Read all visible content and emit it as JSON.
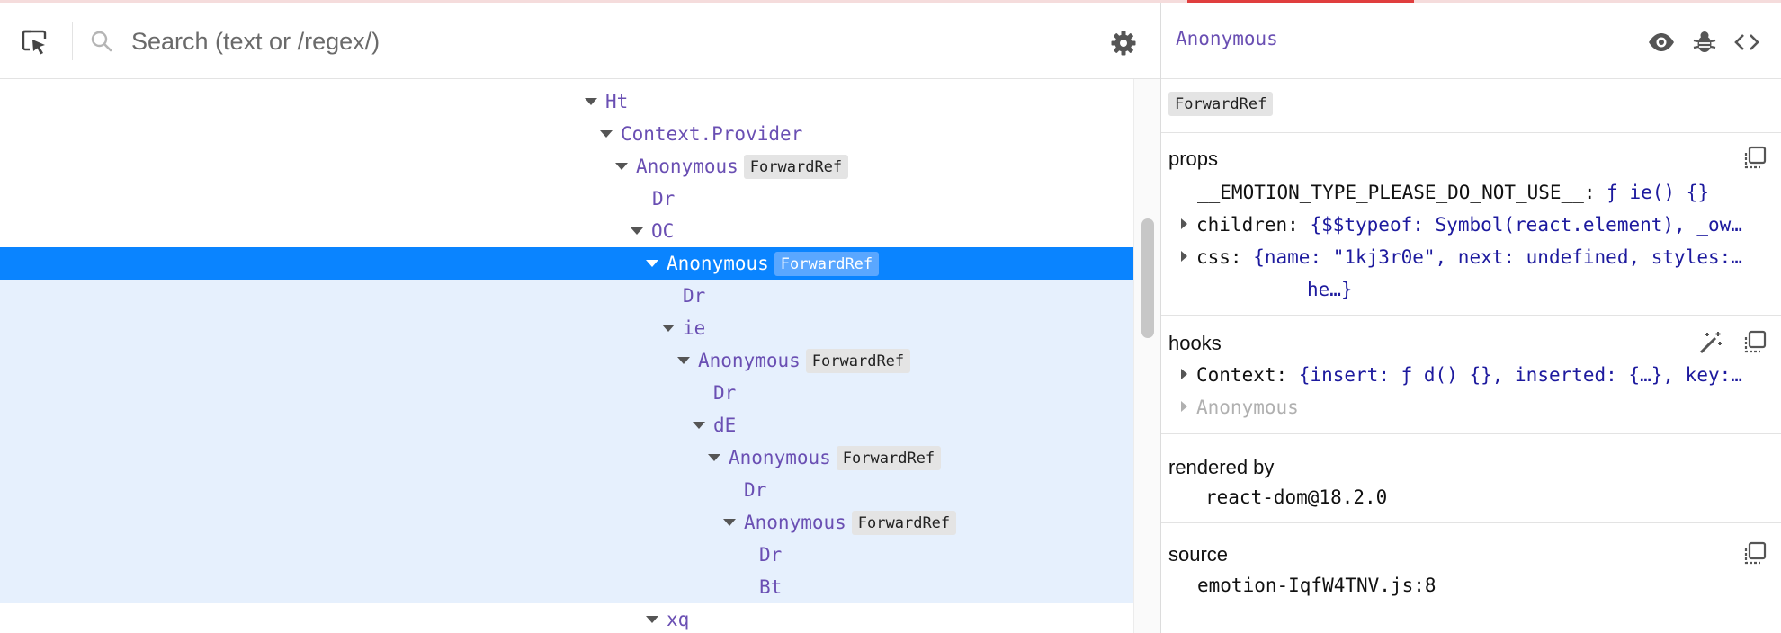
{
  "toolbar": {
    "search_placeholder": "Search (text or /regex/)"
  },
  "tree": {
    "partial_top_label": "ht",
    "rows": [
      {
        "label": "Ht",
        "badge": ""
      },
      {
        "label": "Context.Provider",
        "badge": ""
      },
      {
        "label": "Anonymous",
        "badge": "ForwardRef"
      },
      {
        "label": "Dr",
        "badge": ""
      },
      {
        "label": "OC",
        "badge": ""
      },
      {
        "label": "Anonymous",
        "badge": "ForwardRef"
      },
      {
        "label": "Dr",
        "badge": ""
      },
      {
        "label": "ie",
        "badge": ""
      },
      {
        "label": "Anonymous",
        "badge": "ForwardRef"
      },
      {
        "label": "Dr",
        "badge": ""
      },
      {
        "label": "dE",
        "badge": ""
      },
      {
        "label": "Anonymous",
        "badge": "ForwardRef"
      },
      {
        "label": "Dr",
        "badge": ""
      },
      {
        "label": "Anonymous",
        "badge": "ForwardRef"
      },
      {
        "label": "Dr",
        "badge": ""
      },
      {
        "label": "Bt",
        "badge": ""
      },
      {
        "label": "xq",
        "badge": ""
      }
    ]
  },
  "inspector": {
    "title": "Anonymous",
    "badge": "ForwardRef",
    "props": {
      "title": "props",
      "emotion_key": "__EMOTION_TYPE_PLEASE_DO_NOT_USE__:",
      "emotion_val": "ƒ ie() {}",
      "children_key": "children:",
      "children_val": "{$$typeof: Symbol(react.element), _ow…",
      "css_key": "css:",
      "css_val": "{name: \"1kj3r0e\", next: undefined, styles:…",
      "css_wrap": "he…}"
    },
    "hooks": {
      "title": "hooks",
      "context_key": "Context:",
      "context_val": "{insert: ƒ d() {}, inserted: {…}, key:…",
      "anonymous": "Anonymous"
    },
    "rendered_by": {
      "title": "rendered by",
      "value": "react-dom@18.2.0"
    },
    "source": {
      "title": "source",
      "value": "emotion-IqfW4TNV.js:8"
    }
  },
  "colors": {
    "accent_bar": "#e03e3e",
    "selected_row": "#0a84ff",
    "descendant_bg": "#e6f0fd",
    "component_name": "#6a4fb3",
    "value_text": "#1d1a9e"
  }
}
